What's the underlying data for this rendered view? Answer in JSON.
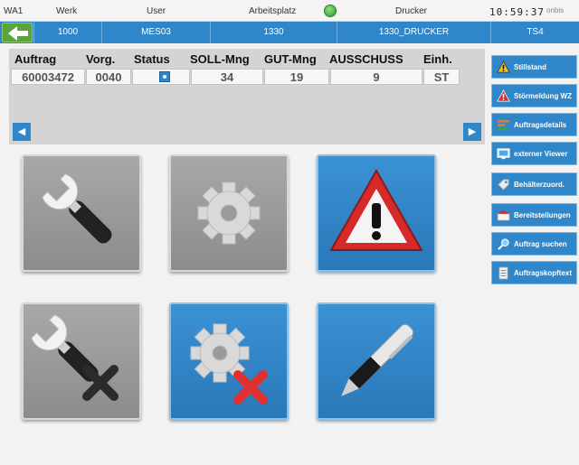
{
  "header": {
    "labels": {
      "station": "WA1",
      "plant": "Werk",
      "user": "User",
      "workplace": "Arbeitsplatz",
      "printer": "Drucker"
    },
    "values": {
      "plant": "1000",
      "user": "MES03",
      "workplace": "1330",
      "printer": "1330_DRUCKER",
      "terminal": "TS4"
    },
    "clock": "10:59:37",
    "brand": "onbis",
    "status_color": "#3aa63a"
  },
  "order_table": {
    "columns": [
      "Auftrag",
      "Vorg.",
      "Status",
      "SOLL-Mng",
      "GUT-Mng",
      "AUSSCHUSS",
      "Einh."
    ],
    "row": {
      "order": "60003472",
      "operation": "0040",
      "target_qty": "34",
      "good_qty": "19",
      "scrap_qty": "9",
      "unit": "ST"
    }
  },
  "scroll": {
    "left": "◀",
    "right": "▶"
  },
  "tiles": [
    {
      "name": "setup",
      "icon": "wrench-icon",
      "color": "grey"
    },
    {
      "name": "production",
      "icon": "gear-icon",
      "color": "grey"
    },
    {
      "name": "fault",
      "icon": "warning-icon",
      "color": "blue"
    },
    {
      "name": "end-setup",
      "icon": "wrench-cancel-icon",
      "color": "grey"
    },
    {
      "name": "stop-production",
      "icon": "gear-cancel-icon",
      "color": "blue"
    },
    {
      "name": "report",
      "icon": "pen-icon",
      "color": "blue"
    }
  ],
  "side_buttons": [
    {
      "label": "Stillstand",
      "icon": "warning-icon"
    },
    {
      "label": "Störmeldung WZ",
      "icon": "alert-icon"
    },
    {
      "label": "Auftragsdetails",
      "icon": "chart-icon"
    },
    {
      "label": "externer Viewer",
      "icon": "monitor-icon"
    },
    {
      "label": "Behälterzuord.",
      "icon": "tag-icon"
    },
    {
      "label": "Bereitstellungen",
      "icon": "box-icon"
    },
    {
      "label": "Auftrag suchen",
      "icon": "search-icon"
    },
    {
      "label": "Auftragskopftext",
      "icon": "document-icon"
    }
  ],
  "colors": {
    "accent": "#2f86c9",
    "panel": "#d4d4d4",
    "tile_grey": "#9a9a9a",
    "danger": "#d62a2a"
  }
}
